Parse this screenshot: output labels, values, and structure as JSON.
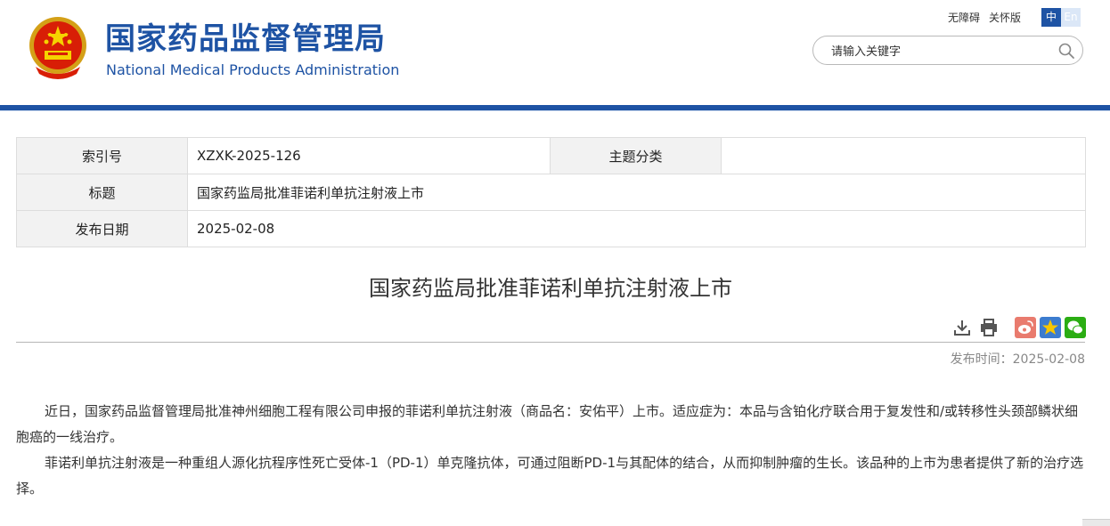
{
  "header": {
    "title_cn": "国家药品监督管理局",
    "title_en": "National Medical Products Administration",
    "links": {
      "accessibility": "无障碍",
      "care": "关怀版"
    },
    "lang": {
      "zh": "中",
      "en": "En"
    },
    "search_placeholder": "请输入关键字",
    "social_icons": [
      "weibo-icon",
      "wechat-icon",
      "mobile-icon",
      "mail-icon",
      "user-icon"
    ]
  },
  "meta": {
    "index_label": "索引号",
    "index_value": "XZXK-2025-126",
    "topic_label": "主题分类",
    "topic_value": "",
    "title_label": "标题",
    "title_value": "国家药监局批准菲诺利单抗注射液上市",
    "date_label": "发布日期",
    "date_value": "2025-02-08"
  },
  "article": {
    "title": "国家药监局批准菲诺利单抗注射液上市",
    "pub_label": "发布时间：",
    "pub_value": "2025-02-08",
    "paragraphs": [
      "近日，国家药品监督管理局批准神州细胞工程有限公司申报的菲诺利单抗注射液（商品名：安佑平）上市。适应症为：本品与含铂化疗联合用于复发性和/或转移性头颈部鳞状细胞癌的一线治疗。",
      "菲诺利单抗注射液是一种重组人源化抗程序性死亡受体-1（PD-1）单克隆抗体，可通过阻断PD-1与其配体的结合，从而抑制肿瘤的生长。该品种的上市为患者提供了新的治疗选择。"
    ]
  },
  "colors": {
    "brand_blue": "#1e53a4",
    "share_weibo": "#e6162d",
    "share_wechat": "#2bad13",
    "share_qzone": "#f7b500"
  }
}
